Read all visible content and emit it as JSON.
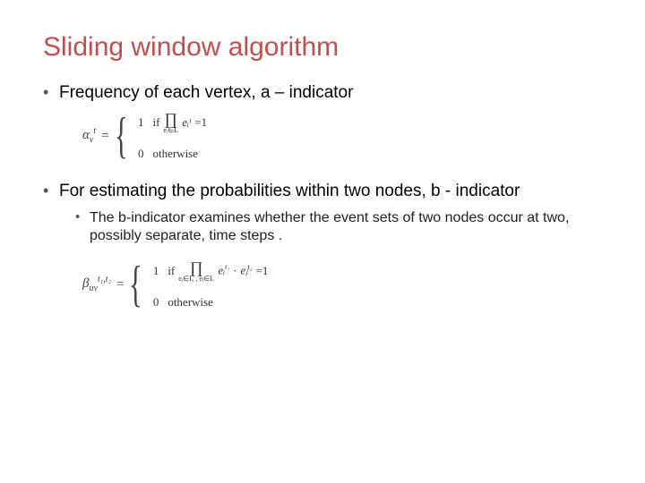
{
  "title": "Sliding window algorithm",
  "bullets": {
    "b1": "Frequency of each vertex, a – indicator",
    "b2": "For estimating the probabilities within two nodes, b - indicator",
    "b2_sub": "The b-indicator examines whether the event sets of two nodes occur at two, possibly separate, time steps ."
  },
  "formula1": {
    "lhs_base": "α",
    "lhs_sub": "v",
    "lhs_sup": "t",
    "eq": "=",
    "case1_val": "1",
    "case1_if": "if",
    "case1_prod_sub": "eᵢ∈Iᵥ",
    "case1_term": "eᵢᵗ",
    "case1_rhs": "=1",
    "case0_val": "0",
    "case0_text": "otherwise"
  },
  "formula2": {
    "lhs_base": "β",
    "lhs_sub": "uv",
    "lhs_sup": "t₁,t₂",
    "eq": "=",
    "case1_val": "1",
    "case1_if": "if",
    "case1_prod_sub": "eᵢ∈Iᵤ , eⱼ∈Iᵥ",
    "case1_term1": "eᵢ",
    "case1_term1_sup": "t₁",
    "case1_dot": "·",
    "case1_term2": "eⱼ",
    "case1_term2_sup": "t₂",
    "case1_rhs": "=1",
    "case0_val": "0",
    "case0_text": "otherwise"
  }
}
